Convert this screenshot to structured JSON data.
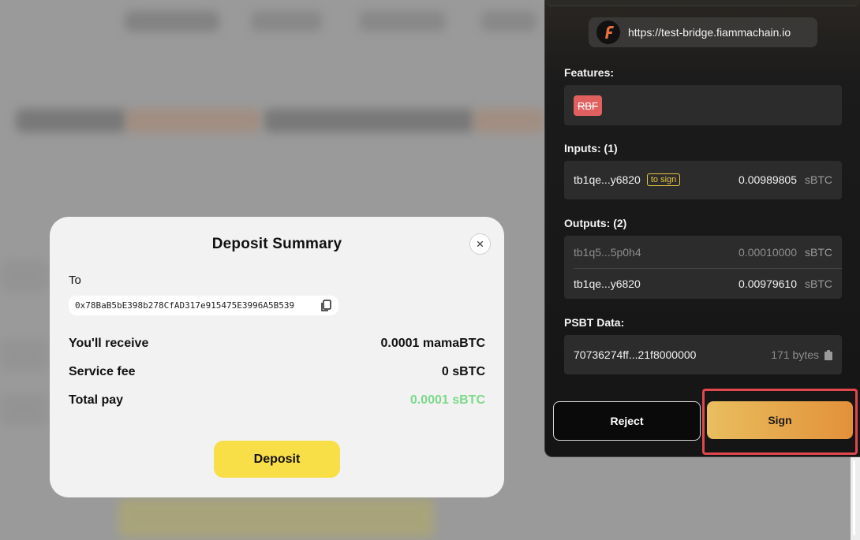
{
  "modal": {
    "title": "Deposit Summary",
    "close_symbol": "×",
    "to_label": "To",
    "to_address": "0x78BaB5bE398b278CfAD317e915475E3996A5B539",
    "rows": [
      {
        "label": "You'll receive",
        "value": "0.0001 mamaBTC"
      },
      {
        "label": "Service fee",
        "value": "0 sBTC"
      },
      {
        "label": "Total pay",
        "value": "0.0001 sBTC"
      }
    ],
    "deposit_label": "Deposit",
    "total_color": "#7cd98b",
    "button_color": "#f8df48"
  },
  "wallet": {
    "site_url": "https://test-bridge.fiammachain.io",
    "features_title": "Features:",
    "features": [
      "RBF"
    ],
    "inputs_title": "Inputs: (1)",
    "inputs": [
      {
        "address": "tb1qe...y6820",
        "tag": "to sign",
        "amount": "0.00989805",
        "unit": "sBTC"
      }
    ],
    "outputs_title": "Outputs: (2)",
    "outputs": [
      {
        "address": "tb1q5...5p0h4",
        "amount": "0.00010000",
        "unit": "sBTC",
        "dimmed": true
      },
      {
        "address": "tb1qe...y6820",
        "amount": "0.00979610",
        "unit": "sBTC",
        "dimmed": false
      }
    ],
    "psbt_title": "PSBT Data:",
    "psbt_data": "70736274ff...21f8000000",
    "psbt_size": "171 bytes",
    "reject_label": "Reject",
    "sign_label": "Sign",
    "accent_color": "#e3913a",
    "highlight_color": "#e2474d"
  }
}
